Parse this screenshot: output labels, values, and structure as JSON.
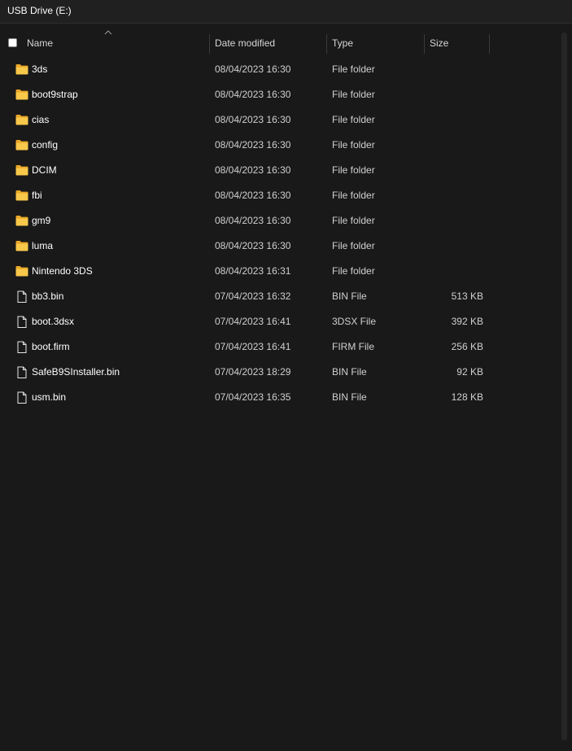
{
  "window": {
    "title": "USB Drive (E:)"
  },
  "columns": {
    "name": "Name",
    "date": "Date modified",
    "type": "Type",
    "size": "Size"
  },
  "colors": {
    "background": "#191919",
    "folder": "#f8c84a",
    "text": "#ffffff"
  },
  "files": [
    {
      "icon": "folder-icon",
      "name": "3ds",
      "date": "08/04/2023 16:30",
      "type": "File folder",
      "size": ""
    },
    {
      "icon": "folder-icon",
      "name": "boot9strap",
      "date": "08/04/2023 16:30",
      "type": "File folder",
      "size": ""
    },
    {
      "icon": "folder-icon",
      "name": "cias",
      "date": "08/04/2023 16:30",
      "type": "File folder",
      "size": ""
    },
    {
      "icon": "folder-icon",
      "name": "config",
      "date": "08/04/2023 16:30",
      "type": "File folder",
      "size": ""
    },
    {
      "icon": "folder-icon",
      "name": "DCIM",
      "date": "08/04/2023 16:30",
      "type": "File folder",
      "size": ""
    },
    {
      "icon": "folder-icon",
      "name": "fbi",
      "date": "08/04/2023 16:30",
      "type": "File folder",
      "size": ""
    },
    {
      "icon": "folder-icon",
      "name": "gm9",
      "date": "08/04/2023 16:30",
      "type": "File folder",
      "size": ""
    },
    {
      "icon": "folder-icon",
      "name": "luma",
      "date": "08/04/2023 16:30",
      "type": "File folder",
      "size": ""
    },
    {
      "icon": "folder-icon",
      "name": "Nintendo 3DS",
      "date": "08/04/2023 16:31",
      "type": "File folder",
      "size": ""
    },
    {
      "icon": "file-icon",
      "name": "bb3.bin",
      "date": "07/04/2023 16:32",
      "type": "BIN File",
      "size": "513 KB"
    },
    {
      "icon": "file-icon",
      "name": "boot.3dsx",
      "date": "07/04/2023 16:41",
      "type": "3DSX File",
      "size": "392 KB"
    },
    {
      "icon": "file-icon",
      "name": "boot.firm",
      "date": "07/04/2023 16:41",
      "type": "FIRM File",
      "size": "256 KB"
    },
    {
      "icon": "file-icon",
      "name": "SafeB9SInstaller.bin",
      "date": "07/04/2023 18:29",
      "type": "BIN File",
      "size": "92 KB"
    },
    {
      "icon": "file-icon",
      "name": "usm.bin",
      "date": "07/04/2023 16:35",
      "type": "BIN File",
      "size": "128 KB"
    }
  ]
}
